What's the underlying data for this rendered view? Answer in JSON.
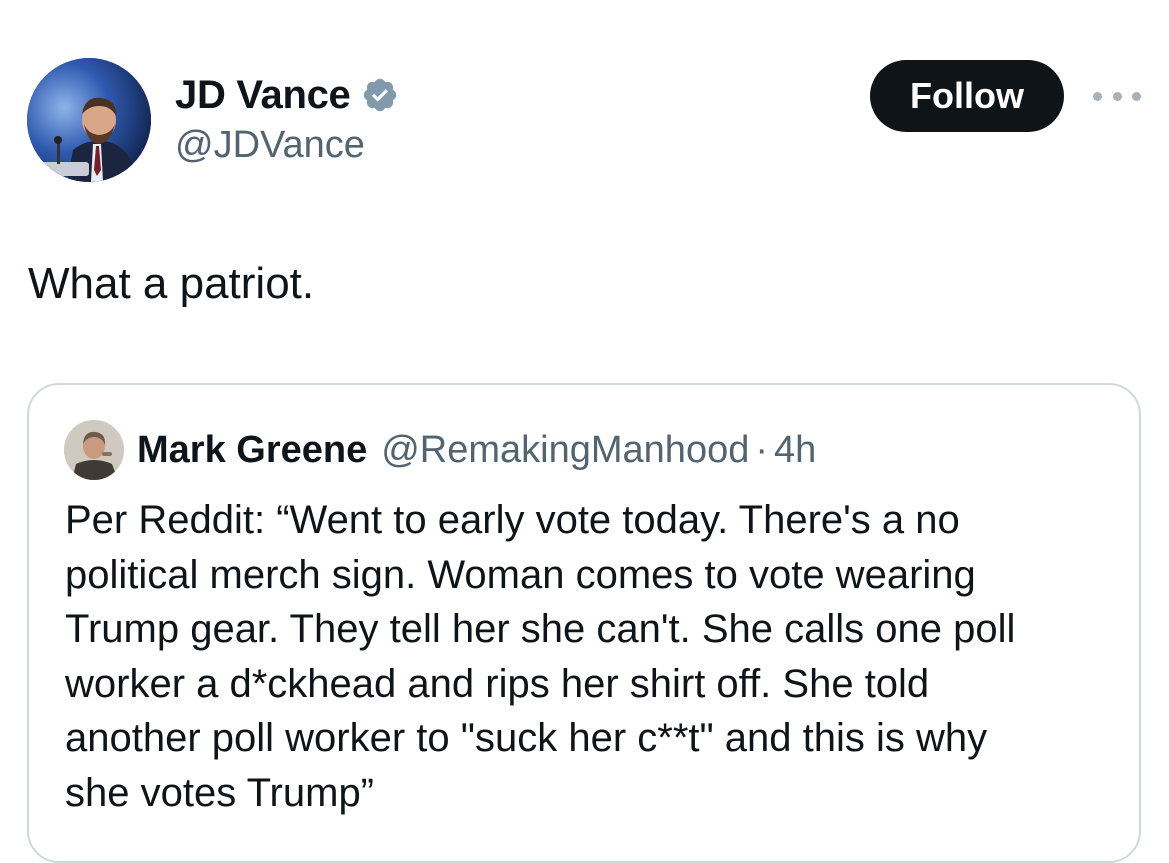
{
  "author": {
    "name": "JD Vance",
    "handle": "@JDVance",
    "verified_color": "#829aab"
  },
  "follow_button": {
    "label": "Follow"
  },
  "more_menu": {
    "icon": "more-horizontal-icon"
  },
  "tweet": {
    "text": "What a patriot."
  },
  "quote": {
    "author_name": "Mark Greene",
    "author_handle": "@RemakingManhood",
    "separator": "·",
    "time": "4h",
    "lines": [
      "Per Reddit: “Went to early vote today. There's a no",
      "political merch sign. Woman comes to vote wearing",
      "Trump gear. They tell her she can't. She calls one poll",
      "worker a d*ckhead and rips her shirt off. She told",
      "another poll worker to \"suck her c**t\" and this is why",
      "she votes Trump”"
    ]
  },
  "colors": {
    "text_primary": "#0f1419",
    "text_secondary": "#536471",
    "border": "#cfd9de",
    "button_bg": "#0f1419"
  }
}
